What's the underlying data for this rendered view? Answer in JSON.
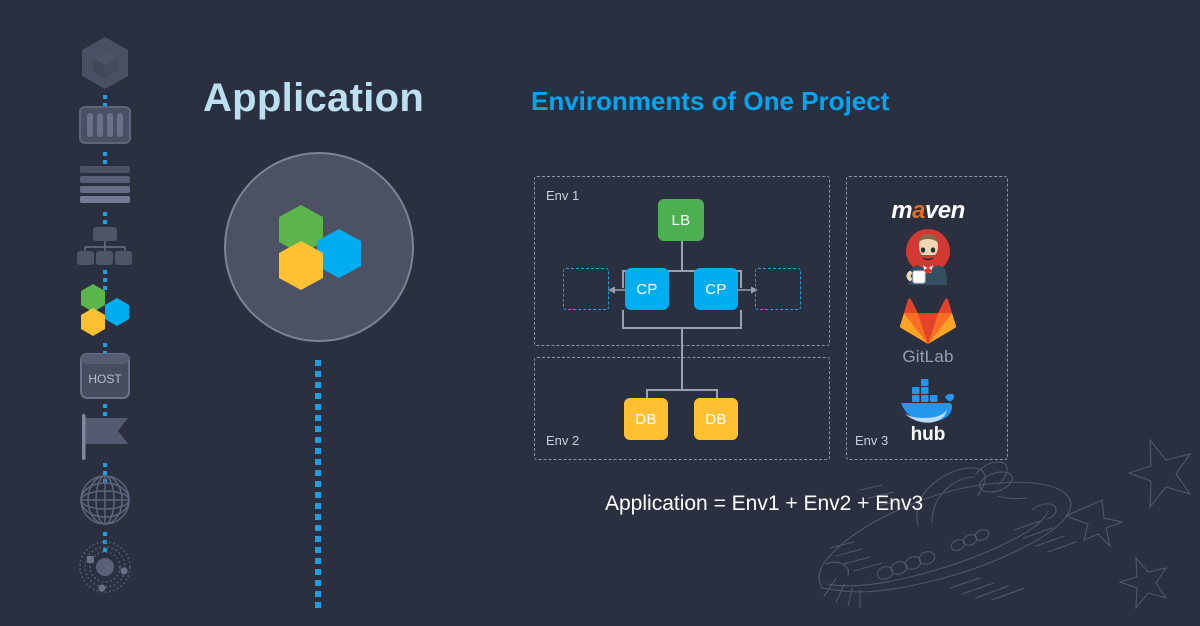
{
  "page": {
    "background_color": "#2b3040",
    "accent_blue": "#00a6ef",
    "title_blue": "#bce0f2"
  },
  "sidebar": {
    "name": "devops-pipeline-rail",
    "items": [
      {
        "id": "hexagon-cube",
        "icon": "hexagon-cube-icon",
        "label": ""
      },
      {
        "id": "server-rack",
        "icon": "server-rack-icon",
        "label": ""
      },
      {
        "id": "layers-stack",
        "icon": "layers-stack-icon",
        "label": ""
      },
      {
        "id": "org-hierarchy",
        "icon": "hierarchy-icon",
        "label": ""
      },
      {
        "id": "hex-cluster",
        "icon": "hexagon-cluster-icon",
        "label": ""
      },
      {
        "id": "host",
        "icon": "host-icon",
        "label": "HOST"
      },
      {
        "id": "flag",
        "icon": "flag-icon",
        "label": ""
      },
      {
        "id": "globe",
        "icon": "globe-icon",
        "label": ""
      },
      {
        "id": "atom-orbit",
        "icon": "atom-orbit-icon",
        "label": ""
      }
    ]
  },
  "application": {
    "title": "Application",
    "hexagons": [
      {
        "name": "green-hexagon",
        "color": "#5cb54b"
      },
      {
        "name": "blue-hexagon",
        "color": "#00aeef"
      },
      {
        "name": "yellow-hexagon",
        "color": "#ffc131"
      }
    ]
  },
  "environments": {
    "title": "Environments of One Project",
    "env1": {
      "label": "Env 1",
      "nodes": [
        {
          "id": "lb",
          "label": "LB",
          "color": "#4caf50"
        },
        {
          "id": "cp-left",
          "label": "CP",
          "color": "#00aeef"
        },
        {
          "id": "cp-right",
          "label": "CP",
          "color": "#00aeef"
        }
      ],
      "placeholders": [
        {
          "id": "ghost-left",
          "label": ""
        },
        {
          "id": "ghost-right",
          "label": ""
        }
      ]
    },
    "env2": {
      "label": "Env 2",
      "nodes": [
        {
          "id": "db-left",
          "label": "DB",
          "color": "#ffc131"
        },
        {
          "id": "db-right",
          "label": "DB",
          "color": "#ffc131"
        }
      ]
    },
    "env3": {
      "label": "Env 3",
      "tools": [
        {
          "id": "maven",
          "name": "maven-logo",
          "text_left": "m",
          "text_accent": "a",
          "text_right": "ven"
        },
        {
          "id": "jenkins",
          "name": "jenkins-logo",
          "text": ""
        },
        {
          "id": "gitlab",
          "name": "gitlab-logo",
          "text": "GitLab"
        },
        {
          "id": "docker",
          "name": "docker-hub-logo",
          "text": "hub"
        }
      ]
    }
  },
  "formula": {
    "text": "Application = Env1 + Env2 + Env3"
  },
  "watermark": {
    "name": "spaceship-sketch"
  }
}
